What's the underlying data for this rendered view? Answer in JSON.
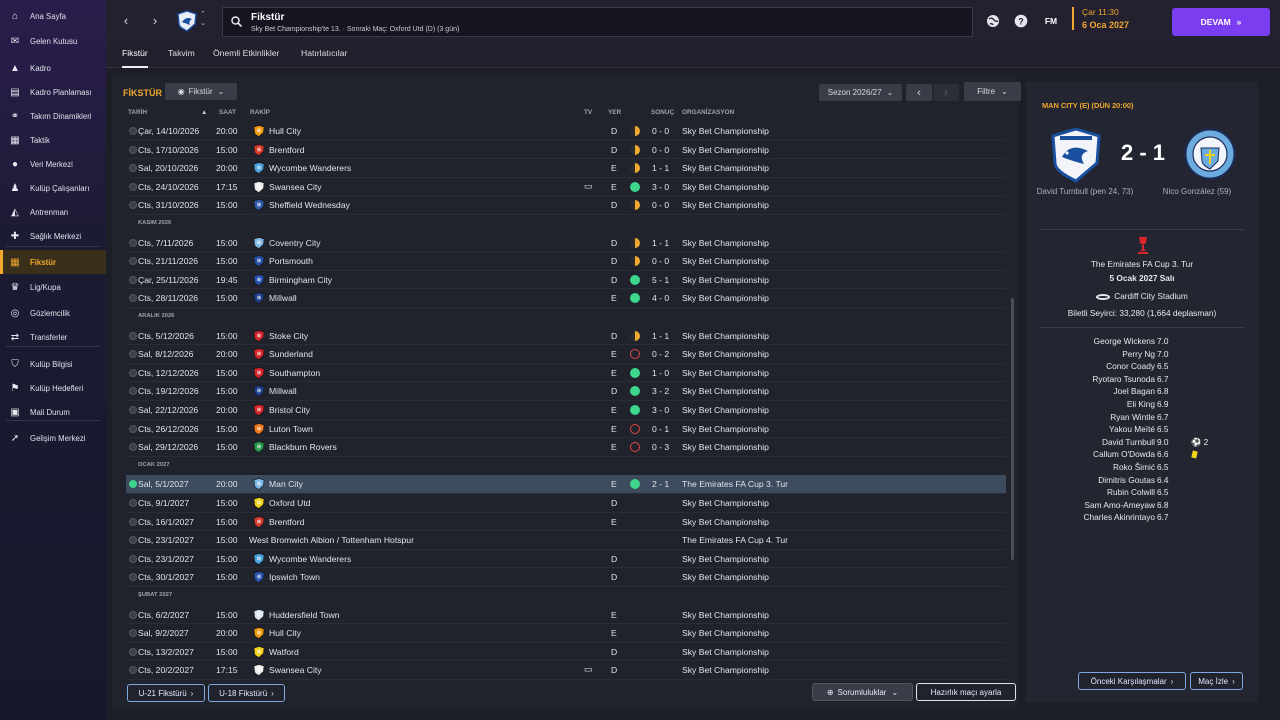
{
  "sidebar": {
    "items": [
      {
        "label": "Ana Sayfa",
        "icon": "home-icon"
      },
      {
        "label": "Gelen Kutusu",
        "icon": "inbox-icon"
      },
      {
        "label": "Kadro",
        "icon": "shirt-icon"
      },
      {
        "label": "Kadro Planlaması",
        "icon": "clipboard-icon"
      },
      {
        "label": "Takım Dinamikleri",
        "icon": "dynamics-icon"
      },
      {
        "label": "Taktik",
        "icon": "tactics-icon"
      },
      {
        "label": "Veri Merkezi",
        "icon": "data-icon"
      },
      {
        "label": "Kulüp Çalışanları",
        "icon": "staff-icon"
      },
      {
        "label": "Antrenman",
        "icon": "training-icon"
      },
      {
        "label": "Sağlık Merkezi",
        "icon": "medical-icon"
      },
      {
        "label": "Fikstür",
        "icon": "calendar-icon",
        "active": true
      },
      {
        "label": "Lig/Kupa",
        "icon": "trophy-icon"
      },
      {
        "label": "Gözlemcilik",
        "icon": "scouting-icon"
      },
      {
        "label": "Transferler",
        "icon": "transfer-icon"
      },
      {
        "label": "Kulüp Bilgisi",
        "icon": "club-shield-icon"
      },
      {
        "label": "Kulüp Hedefleri",
        "icon": "goals-icon"
      },
      {
        "label": "Mali Durum",
        "icon": "finance-icon"
      },
      {
        "label": "Gelişim Merkezi",
        "icon": "development-icon"
      }
    ]
  },
  "header": {
    "title": "Fikstür",
    "subtitle": "Sky Bet Championship'te 13. · Sonraki Maç: Oxford Utd (D) (3 gün)",
    "time": "Çar 11:30",
    "date": "6 Oca 2027",
    "continue_label": "DEVAM",
    "fm_label": "FM"
  },
  "tabs": [
    "Fikstür",
    "Takvim",
    "Önemli Etkinlikler",
    "Hatırlatıcılar"
  ],
  "panel": {
    "title": "FİKSTÜR",
    "view_dropdown": "Fikstür",
    "season": "Sezon 2026/27",
    "filter": "Filtre"
  },
  "columns": {
    "date": "TARİH",
    "time": "SAAT",
    "opponent": "RAKİP",
    "tv": "TV",
    "venue": "YER",
    "result": "SONUÇ",
    "competition": "ORGANİZASYON"
  },
  "colors": {
    "accent": "#f0a830",
    "win": "#3dd68c",
    "loss": "#e04545",
    "continue": "#7a3df0"
  },
  "fixtures": [
    {
      "date": "Çar, 14/10/2026",
      "time": "20:00",
      "opponent": "Hull City",
      "tv": "",
      "venue": "D",
      "res": "d",
      "score": "0 - 0",
      "comp": "Sky Bet Championship",
      "crest": "#f39c12"
    },
    {
      "date": "Cts, 17/10/2026",
      "time": "15:00",
      "opponent": "Brentford",
      "tv": "",
      "venue": "D",
      "res": "d",
      "score": "0 - 0",
      "comp": "Sky Bet Championship",
      "crest": "#d63a2f"
    },
    {
      "date": "Sal, 20/10/2026",
      "time": "20:00",
      "opponent": "Wycombe Wanderers",
      "tv": "",
      "venue": "E",
      "res": "d",
      "score": "1 - 1",
      "comp": "Sky Bet Championship",
      "crest": "#4aa3df"
    },
    {
      "date": "Cts, 24/10/2026",
      "time": "17:15",
      "opponent": "Swansea City",
      "tv": "tv",
      "venue": "E",
      "res": "w",
      "score": "3 - 0",
      "comp": "Sky Bet Championship",
      "crest": "#eeeeee"
    },
    {
      "date": "Cts, 31/10/2026",
      "time": "15:00",
      "opponent": "Sheffield Wednesday",
      "tv": "",
      "venue": "D",
      "res": "d",
      "score": "0 - 0",
      "comp": "Sky Bet Championship",
      "crest": "#2e5ca8"
    },
    {
      "month": "KASIM 2026"
    },
    {
      "date": "Cts, 7/11/2026",
      "time": "15:00",
      "opponent": "Coventry City",
      "tv": "",
      "venue": "D",
      "res": "d",
      "score": "1 - 1",
      "comp": "Sky Bet Championship",
      "crest": "#7fbbe8"
    },
    {
      "date": "Cts, 21/11/2026",
      "time": "15:00",
      "opponent": "Portsmouth",
      "tv": "",
      "venue": "D",
      "res": "d",
      "score": "0 - 0",
      "comp": "Sky Bet Championship",
      "crest": "#2250a8"
    },
    {
      "date": "Çar, 25/11/2026",
      "time": "19:45",
      "opponent": "Birmingham City",
      "tv": "",
      "venue": "D",
      "res": "w",
      "score": "5 - 1",
      "comp": "Sky Bet Championship",
      "crest": "#2350b0"
    },
    {
      "date": "Cts, 28/11/2026",
      "time": "15:00",
      "opponent": "Millwall",
      "tv": "",
      "venue": "E",
      "res": "w",
      "score": "4 - 0",
      "comp": "Sky Bet Championship",
      "crest": "#1d3f8a"
    },
    {
      "month": "ARALIK 2026"
    },
    {
      "date": "Cts, 5/12/2026",
      "time": "15:00",
      "opponent": "Stoke City",
      "tv": "",
      "venue": "D",
      "res": "d",
      "score": "1 - 1",
      "comp": "Sky Bet Championship",
      "crest": "#d0262c"
    },
    {
      "date": "Sal, 8/12/2026",
      "time": "20:00",
      "opponent": "Sunderland",
      "tv": "",
      "venue": "E",
      "res": "l",
      "score": "0 - 2",
      "comp": "Sky Bet Championship",
      "crest": "#d8262c"
    },
    {
      "date": "Cts, 12/12/2026",
      "time": "15:00",
      "opponent": "Southampton",
      "tv": "",
      "venue": "E",
      "res": "w",
      "score": "1 - 0",
      "comp": "Sky Bet Championship",
      "crest": "#d8262c"
    },
    {
      "date": "Cts, 19/12/2026",
      "time": "15:00",
      "opponent": "Millwall",
      "tv": "",
      "venue": "D",
      "res": "w",
      "score": "3 - 2",
      "comp": "Sky Bet Championship",
      "crest": "#1d3f8a"
    },
    {
      "date": "Sal, 22/12/2026",
      "time": "20:00",
      "opponent": "Bristol City",
      "tv": "",
      "venue": "E",
      "res": "w",
      "score": "3 - 0",
      "comp": "Sky Bet Championship",
      "crest": "#d8262c"
    },
    {
      "date": "Cts, 26/12/2026",
      "time": "15:00",
      "opponent": "Luton Town",
      "tv": "",
      "venue": "E",
      "res": "l",
      "score": "0 - 1",
      "comp": "Sky Bet Championship",
      "crest": "#f07a1a"
    },
    {
      "date": "Sal, 29/12/2026",
      "time": "15:00",
      "opponent": "Blackburn Rovers",
      "tv": "",
      "venue": "E",
      "res": "l",
      "score": "0 - 3",
      "comp": "Sky Bet Championship",
      "crest": "#2a9a4a"
    },
    {
      "month": "OCAK 2027"
    },
    {
      "date": "Sal, 5/1/2027",
      "time": "20:00",
      "opponent": "Man City",
      "tv": "",
      "venue": "E",
      "res": "w",
      "score": "2 - 1",
      "comp": "The Emirates FA Cup 3. Tur",
      "crest": "#7bb8e6",
      "sel": true
    },
    {
      "date": "Cts, 9/1/2027",
      "time": "15:00",
      "opponent": "Oxford Utd",
      "tv": "",
      "venue": "D",
      "res": "",
      "score": "",
      "comp": "Sky Bet Championship",
      "crest": "#f2d21a"
    },
    {
      "date": "Cts, 16/1/2027",
      "time": "15:00",
      "opponent": "Brentford",
      "tv": "",
      "venue": "E",
      "res": "",
      "score": "",
      "comp": "Sky Bet Championship",
      "crest": "#d63a2f"
    },
    {
      "date": "Cts, 23/1/2027",
      "time": "15:00",
      "opponent": "West Bromwich Albion / Tottenham Hotspur",
      "tv": "",
      "venue": "",
      "res": "",
      "score": "",
      "comp": "The Emirates FA Cup 4. Tur",
      "nocrest": true
    },
    {
      "date": "Cts, 23/1/2027",
      "time": "15:00",
      "opponent": "Wycombe Wanderers",
      "tv": "",
      "venue": "D",
      "res": "",
      "score": "",
      "comp": "Sky Bet Championship",
      "crest": "#4aa3df"
    },
    {
      "date": "Cts, 30/1/2027",
      "time": "15:00",
      "opponent": "Ipswich Town",
      "tv": "",
      "venue": "D",
      "res": "",
      "score": "",
      "comp": "Sky Bet Championship",
      "crest": "#2a56b0"
    },
    {
      "month": "ŞUBAT 2027"
    },
    {
      "date": "Cts, 6/2/2027",
      "time": "15:00",
      "opponent": "Huddersfield Town",
      "tv": "",
      "venue": "E",
      "res": "",
      "score": "",
      "comp": "Sky Bet Championship",
      "crest": "#dde6f5"
    },
    {
      "date": "Sal, 9/2/2027",
      "time": "20:00",
      "opponent": "Hull City",
      "tv": "",
      "venue": "E",
      "res": "",
      "score": "",
      "comp": "Sky Bet Championship",
      "crest": "#f39c12"
    },
    {
      "date": "Cts, 13/2/2027",
      "time": "15:00",
      "opponent": "Watford",
      "tv": "",
      "venue": "D",
      "res": "",
      "score": "",
      "comp": "Sky Bet Championship",
      "crest": "#f2d21a"
    },
    {
      "date": "Cts, 20/2/2027",
      "time": "17:15",
      "opponent": "Swansea City",
      "tv": "tv",
      "venue": "D",
      "res": "",
      "score": "",
      "comp": "Sky Bet Championship",
      "crest": "#eeeeee"
    }
  ],
  "bottom": {
    "u21": "U-21 Fikstürü",
    "u18": "U-18 Fikstürü",
    "resp": "Sorumluluklar",
    "friendly": "Hazırlık maçı ayarla"
  },
  "match": {
    "header": "MAN CITY (E) (DÜN 20:00)",
    "score": "2 - 1",
    "home_scorer": "David Turnbull (pen 24, 73)",
    "away_scorer": "Nico González (59)",
    "competition": "The Emirates FA Cup 3. Tur",
    "date": "5 Ocak 2027 Salı",
    "stadium": "Cardiff City Stadium",
    "attendance": "Biletli Seyirci: 33,280 (1,664 deplasman)",
    "prev_button": "Önceki Karşılaşmalar",
    "watch_button": "Maç İzle",
    "players": [
      {
        "name": "George Wickens",
        "rating": "7.0"
      },
      {
        "name": "Perry Ng",
        "rating": "7.0"
      },
      {
        "name": "Conor Coady",
        "rating": "6.5"
      },
      {
        "name": "Ryotaro Tsunoda",
        "rating": "6.7"
      },
      {
        "name": "Joel Bagan",
        "rating": "6.8"
      },
      {
        "name": "Eli King",
        "rating": "6.9"
      },
      {
        "name": "Ryan Wintle",
        "rating": "6.7"
      },
      {
        "name": "Yakou Meïté",
        "rating": "6.5"
      },
      {
        "name": "David Turnbull",
        "rating": "9.0",
        "goals": "2"
      },
      {
        "name": "Callum O'Dowda",
        "rating": "6.6",
        "card": "yellow"
      },
      {
        "name": "Roko Šimić",
        "rating": "6.5"
      },
      {
        "name": "Dimitris Goutas",
        "rating": "6.4"
      },
      {
        "name": "Rubin Colwill",
        "rating": "6.5"
      },
      {
        "name": "Sam Amo-Ameyaw",
        "rating": "6.8"
      },
      {
        "name": "Charles Akinrintayo",
        "rating": "6.7"
      }
    ]
  }
}
